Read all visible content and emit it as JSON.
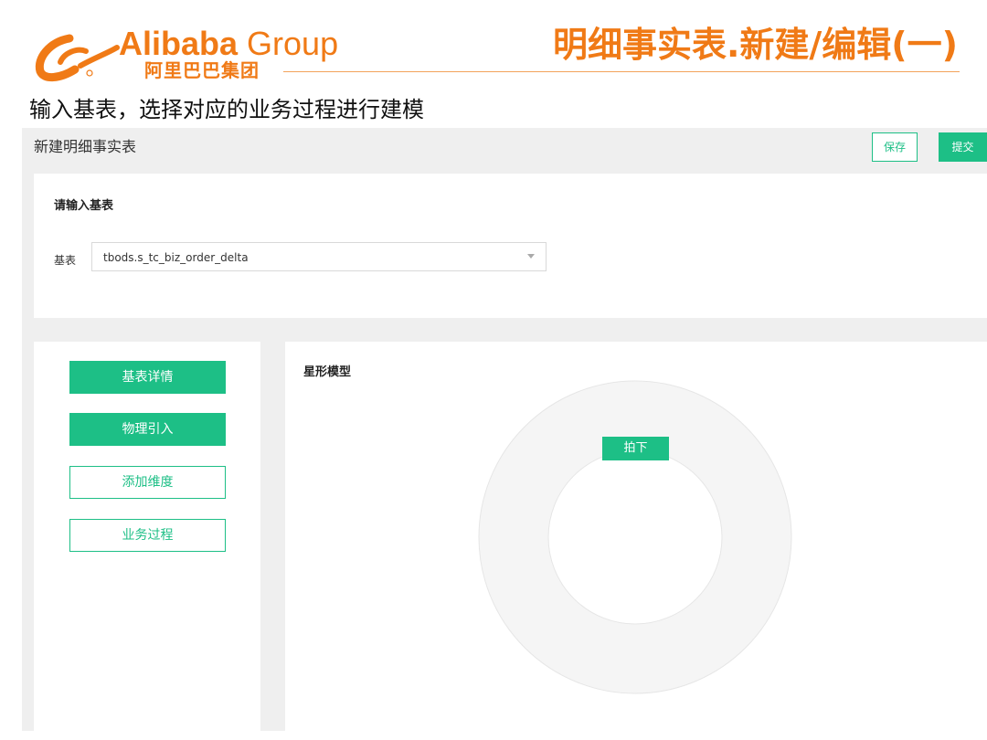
{
  "slide": {
    "brand_en_bold": "Alibaba",
    "brand_en_light": "Group",
    "brand_cn": "阿里巴巴集团",
    "title": "明细事实表.新建/编辑(一)",
    "subtitle": "输入基表，选择对应的业务过程进行建模",
    "brand_color": "#f07a16"
  },
  "app": {
    "page_title": "新建明细事实表",
    "save_label": "保存",
    "submit_label": "提交",
    "accent_color": "#1dbf86",
    "base_section": {
      "title": "请输入基表",
      "field_label": "基表",
      "selected_table": "tbods.s_tc_biz_order_delta"
    },
    "side_buttons": [
      {
        "label": "基表详情",
        "style": "solid"
      },
      {
        "label": "物理引入",
        "style": "solid"
      },
      {
        "label": "添加维度",
        "style": "outline"
      },
      {
        "label": "业务过程",
        "style": "outline"
      }
    ],
    "star_model": {
      "title": "星形模型",
      "fact_label": "拍下"
    }
  }
}
